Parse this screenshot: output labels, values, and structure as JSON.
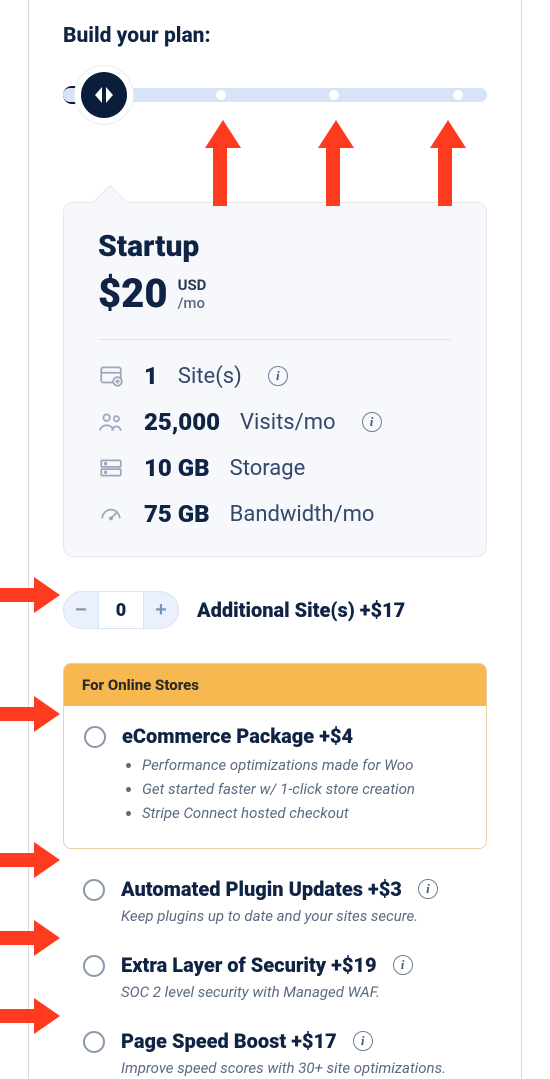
{
  "title": "Build your plan:",
  "slider": {
    "steps": 4,
    "selected_index": 0
  },
  "plan": {
    "name": "Startup",
    "price": "$20",
    "currency": "USD",
    "period": "/mo",
    "specs": [
      {
        "icon": "site-icon",
        "value": "1",
        "label": "Site(s)",
        "info": true
      },
      {
        "icon": "visits-icon",
        "value": "25,000",
        "label": "Visits/mo",
        "info": true
      },
      {
        "icon": "storage-icon",
        "value": "10 GB",
        "label": "Storage",
        "info": false
      },
      {
        "icon": "bandwidth-icon",
        "value": "75 GB",
        "label": "Bandwidth/mo",
        "info": false
      }
    ]
  },
  "additional_sites": {
    "value": "0",
    "label": "Additional Site(s) +$17"
  },
  "ecommerce": {
    "badge": "For Online Stores",
    "title": "eCommerce Package +$4",
    "bullets": [
      "Performance optimizations made for Woo",
      "Get started faster w/ 1-click store creation",
      "Stripe Connect hosted checkout"
    ]
  },
  "addons": [
    {
      "title": "Automated Plugin Updates +$3",
      "desc": "Keep plugins up to date and your sites secure.",
      "info": true
    },
    {
      "title": "Extra Layer of Security +$19",
      "desc": "SOC 2 level security with Managed WAF.",
      "info": true
    },
    {
      "title": "Page Speed Boost +$17",
      "desc": "Improve speed scores with 30+ site optimizations.",
      "info": true
    }
  ]
}
